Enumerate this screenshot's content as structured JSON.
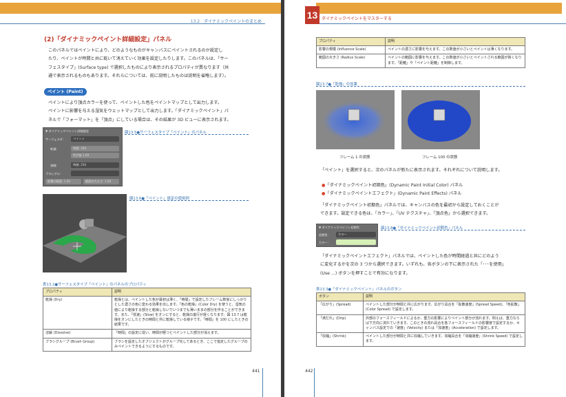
{
  "left": {
    "header": "13.2　ダイナミックペイントのまとめ",
    "section_title": "(2)「ダイナミックペイント詳細設定」パネル",
    "intro": [
      "このパネルではペイントにより、どのようなものがキャンバスにペイントされるのか設定し",
      "たり、ペイントが時間と共に乾いて消えていく効果を設定したりします。このパネルは、「サー",
      "フェスタイプ」(Surface type) で選択したものにより表示されるプロパティが異なります（共",
      "通で表示されるものもあります。それらについては、前に説明したものは説明を省略します）。"
    ],
    "pill": "ペイント (Paint)",
    "paint_text": [
      "ペイントにより頂点カラーを使って、ペイントした色をペイントマップとして出力します。",
      "ペイントに影響を与える湿気をウェットマップとして出力します。「ダイナミックペイント」パ",
      "ネルで「フォーマット」を「頂点」にしている場合は、その結果が 3D ビューに表示されます。"
    ],
    "fig5_caption": "図13.5●サーフェスタイプ「ペイント」のパネル",
    "fig6_caption": "図13.6●「ペイント」設定の使用例",
    "panel_ui": {
      "title": "▼ ダイナミックペイント詳細設定",
      "surface_label": "サーフェスタ:",
      "surface_value": "ペイント",
      "dry_label": "乾燥:",
      "time_label": "時間:",
      "time_value": "300",
      "color_label": "色が抜",
      "color_value": "1.00",
      "dissolve_label": "溶融:",
      "dissolve_time": "時間: 250",
      "brush_label": "ブラシグル:",
      "shrink1": "影響の範囲: 1.00",
      "shrink2": "範囲の大きさ: 1.00"
    },
    "table_caption": "表13.2●サーフェスタイプ「ペイント」のパネルのプロパティ",
    "table_headers": [
      "プロパティ",
      "説明"
    ],
    "table_rows": [
      [
        "乾燥 (Dry)",
        "乾燥とは、ペイントした色が最初は薄く、「時間」で設定したフレーム数後にしっかりとした濃さの色に変わる効果を出します。「色の乾燥」(Color Dry) を使うと、湿気の値により乾燥する部分と乾燥しないでいつまでも薄いままの部分を作ることができます。また、「低速」(Slow) をオンにすると、乾燥の進行が遅くなります。図 13.7 は乾燥をオンにしたときの時間と共に乾燥している様子です。「時間」を 100 にしたときの結果です。"
      ],
      [
        "溶解 (Dissolve)",
        "「時間」の設定に従い、時間が経つとペイントした部分が消えます。"
      ],
      [
        "ブラシグループ (Brush Group)",
        "ブラシを設定したオブジェクトがグループ化してあるとき、ここで指定したグループのみペイントできるようにするものです。"
      ]
    ],
    "page_number": "441"
  },
  "right": {
    "chapter_number": "13",
    "chapter_title": "ダイナミックペイントをマスターする",
    "top_table_headers": [
      "プロパティ",
      "説明"
    ],
    "top_table_rows": [
      [
        "影響の規模 (Influence Scale)",
        "ペイントの濃さに影響を与えます。この数値が小さいとペイントは薄くなります。"
      ],
      [
        "範囲の大きさ (Radius Scale)",
        "ペイントの範囲に影響を与えます。この数値が小さいとペイントされる範囲が狭くなります。「距離」や「ペイント距離」を制御します。"
      ]
    ],
    "fig7_caption": "図13.7●「乾燥」の効果",
    "frame1_label": "フレーム 1 の状態",
    "frame100_label": "フレーム 100 の状態",
    "p1": "「ペイント」を選択すると、次のパネルが新たに表示されます。それぞれについて説明します。",
    "bullets": [
      "「ダイナミックペイント初期色」(Dynamic Paint Initial Color) パネル",
      "「ダイナミックペイントエフェクト」(Dynamic Paint Effects) パネル"
    ],
    "p2": [
      "「ダイナミックペイント初期色」パネルでは、キャンバスの色を最初から設定しておくことが",
      "できます。設定できる色は、「カラー」、「UV テクスチャ」、「頂点色」から選択できます。"
    ],
    "fig8_caption": "図13.8●「ダイナミックペイント初期色」パネル",
    "init_panel": {
      "title": "▼ ダイナミックペイント初期色",
      "init_label": "初期色:",
      "init_value": "カラー",
      "color_label": "カラー:"
    },
    "p3": [
      "「ダイナミックペイントエフェクト」パネルでは、ペイントした色が時間経過と共にどのよう",
      "に変化するかを次の 3 つから選択できます。いずれも、各ボタンの下に表示された「･･･を使用」",
      "(Use ...) ボタンを押すことで有効になります。"
    ],
    "table_caption": "表13.3●「ダイナミックペイント」パネルのボタン",
    "bottom_table_headers": [
      "ボタン",
      "説明"
    ],
    "bottom_table_rows": [
      [
        "「広がり」(Spread)",
        "ペイントした部分が時間と共に広がります。広がり具合を「拡散速度」(Spread Speed)、「色拡散」(Color Spread) で設定します。"
      ],
      [
        "「滴だれ」(Drip)",
        "外部のフォースフィールドによるか、重力の影響によりペイント部分が流れます。例えば、重力ならば下方向に流れていきます。このときの流れ具合を各フォースフィールドの影響度で設定するか、キャンバス設定での「速度」(Velocity) または「加速度」(Acceleration) で設定します。"
      ],
      [
        "「収縮」(Shrink)",
        "ペイントした部分が時間と共に収縮していきます。収縮具合を「収縮速度」(Shrink Speed) で設定します。"
      ]
    ],
    "page_number": "442"
  },
  "colors": {
    "accent_red": "#c0392b",
    "accent_blue": "#2d6fbf",
    "header_orange": "#e8a33c",
    "table_header": "#efe7b5"
  }
}
